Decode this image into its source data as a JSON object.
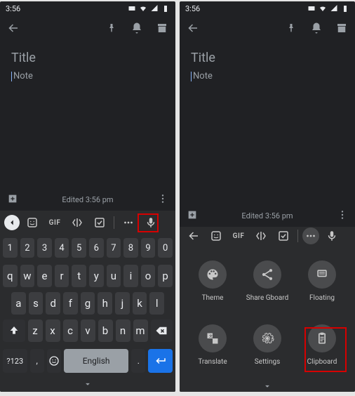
{
  "status": {
    "time": "3:56"
  },
  "editor": {
    "title_placeholder": "Title",
    "note_placeholder": "Note",
    "edited_label": "Edited 3:56 pm"
  },
  "kb_toolbar": {
    "gif_label": "GIF"
  },
  "keys": {
    "numbers": [
      "1",
      "2",
      "3",
      "4",
      "5",
      "6",
      "7",
      "8",
      "9",
      "0"
    ],
    "row1": [
      "q",
      "w",
      "e",
      "r",
      "t",
      "y",
      "u",
      "i",
      "o",
      "p"
    ],
    "row2": [
      "a",
      "s",
      "d",
      "f",
      "g",
      "h",
      "j",
      "k",
      "l"
    ],
    "row3": [
      "z",
      "x",
      "c",
      "v",
      "b",
      "n",
      "m"
    ],
    "symbols_label": "?123",
    "comma": ",",
    "period": ".",
    "space_label": "English"
  },
  "tools": {
    "theme": "Theme",
    "share": "Share Gboard",
    "floating": "Floating",
    "translate": "Translate",
    "settings": "Settings",
    "clipboard": "Clipboard"
  }
}
